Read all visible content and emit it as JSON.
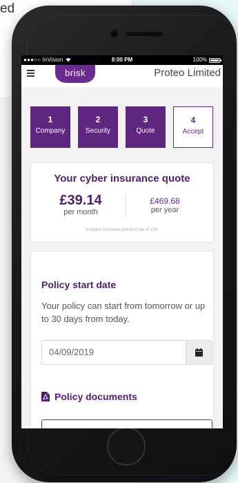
{
  "background": {
    "partial_text": "ed"
  },
  "status_bar": {
    "carrier": "●●●○○ InVision",
    "time": "8:00 PM",
    "battery": "100%"
  },
  "header": {
    "logo": "brisk",
    "company": "Proteo Limited"
  },
  "steps": [
    {
      "num": "1",
      "label": "Company"
    },
    {
      "num": "2",
      "label": "Security"
    },
    {
      "num": "3",
      "label": "Quote"
    },
    {
      "num": "4",
      "label": "Accept"
    }
  ],
  "quote": {
    "title": "Your cyber insurance quote",
    "monthly_amount": "£39.14",
    "monthly_label": "per month",
    "yearly_amount": "£469.68",
    "yearly_label": "per year",
    "note": "Includes insurance premium tax of 12%"
  },
  "policy": {
    "title": "Policy start date",
    "description": "Your policy can start from tomorrow or up to 30 days from today.",
    "date_value": "04/09/2019"
  },
  "documents": {
    "title": "Policy documents"
  },
  "colors": {
    "brand": "#6b2c8f",
    "step_fill": "#5f2680",
    "heading": "#4f1e6d"
  },
  "icons": {
    "menu": "hamburger-icon",
    "calendar": "calendar-icon",
    "pdf": "pdf-file-icon",
    "wifi": "wifi-icon",
    "battery": "battery-icon"
  }
}
